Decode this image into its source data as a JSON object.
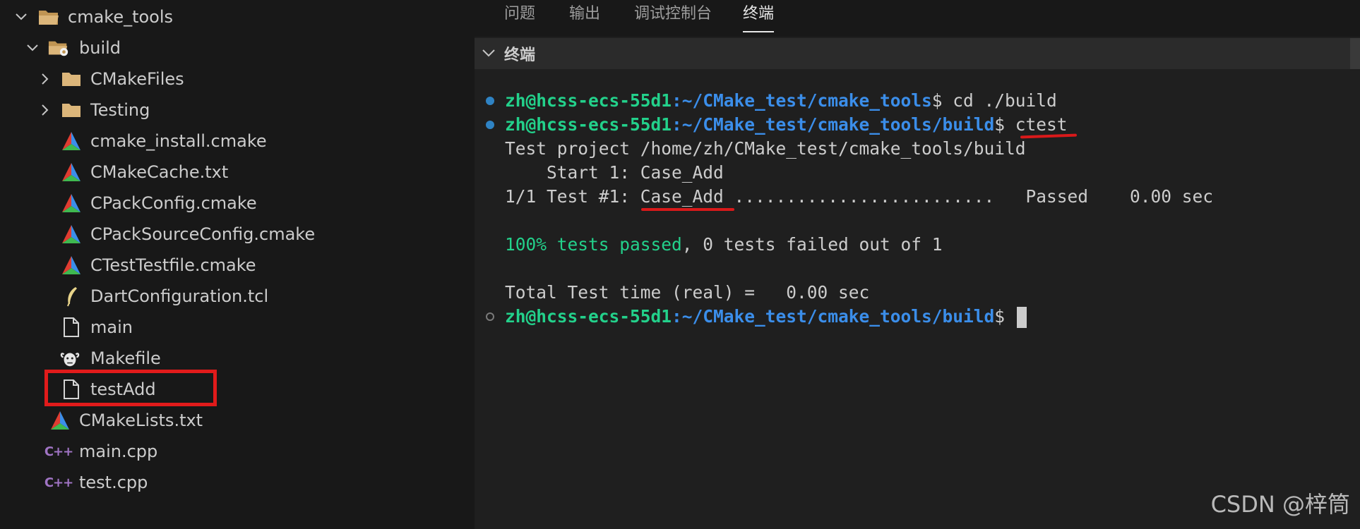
{
  "explorer": {
    "items": [
      {
        "label": "cmake_tools",
        "kind": "folder-open",
        "icon": "folder-open-icon"
      },
      {
        "label": "build",
        "kind": "folder-open",
        "icon": "folder-gear-icon"
      },
      {
        "label": "CMakeFiles",
        "kind": "folder",
        "icon": "folder-icon"
      },
      {
        "label": "Testing",
        "kind": "folder",
        "icon": "folder-icon"
      },
      {
        "label": "cmake_install.cmake",
        "kind": "cmake",
        "icon": "cmake-icon"
      },
      {
        "label": "CMakeCache.txt",
        "kind": "cmake",
        "icon": "cmake-icon"
      },
      {
        "label": "CPackConfig.cmake",
        "kind": "cmake",
        "icon": "cmake-icon"
      },
      {
        "label": "CPackSourceConfig.cmake",
        "kind": "cmake",
        "icon": "cmake-icon"
      },
      {
        "label": "CTestTestfile.cmake",
        "kind": "cmake",
        "icon": "cmake-icon"
      },
      {
        "label": "DartConfiguration.tcl",
        "kind": "tcl",
        "icon": "feather-icon"
      },
      {
        "label": "main",
        "kind": "file",
        "icon": "file-icon"
      },
      {
        "label": "Makefile",
        "kind": "makefile",
        "icon": "gnu-icon"
      },
      {
        "label": "testAdd",
        "kind": "file",
        "icon": "file-icon"
      },
      {
        "label": "CMakeLists.txt",
        "kind": "cmake",
        "icon": "cmake-icon"
      },
      {
        "label": "main.cpp",
        "kind": "cpp",
        "icon": "cpp-icon"
      },
      {
        "label": "test.cpp",
        "kind": "cpp",
        "icon": "cpp-icon"
      }
    ]
  },
  "panel": {
    "tabs": [
      {
        "label": "问题"
      },
      {
        "label": "输出"
      },
      {
        "label": "调试控制台"
      },
      {
        "label": "终端"
      }
    ],
    "active_tab": "终端",
    "terminal_header": "终端"
  },
  "terminal": {
    "prompt_user": "zh@hcss-ecs-55d1",
    "line1": {
      "path": ":~/CMake_test/cmake_tools",
      "cmd": "$ cd ./build"
    },
    "line2": {
      "path": ":~/CMake_test/cmake_tools/build",
      "cmd_prefix": "$ ",
      "cmd": "ctest"
    },
    "line3": "Test project /home/zh/CMake_test/cmake_tools/build",
    "line4": "    Start 1: Case_Add",
    "line5": {
      "prefix": "1/1 Test #1: ",
      "name": "Case_Add",
      "suffix": " .........................   Passed    0.00 sec"
    },
    "line6": {
      "green": "100% tests passed",
      "rest": ", 0 tests failed out of 1"
    },
    "line7": "Total Test time (real) =   0.00 sec",
    "line8": {
      "path": ":~/CMake_test/cmake_tools/build",
      "cmd": "$ "
    }
  },
  "watermark": "CSDN @梓筒",
  "colors": {
    "prompt_user": "#23d18b",
    "prompt_path": "#3b8eea",
    "annotation_red": "#e11b1b"
  }
}
